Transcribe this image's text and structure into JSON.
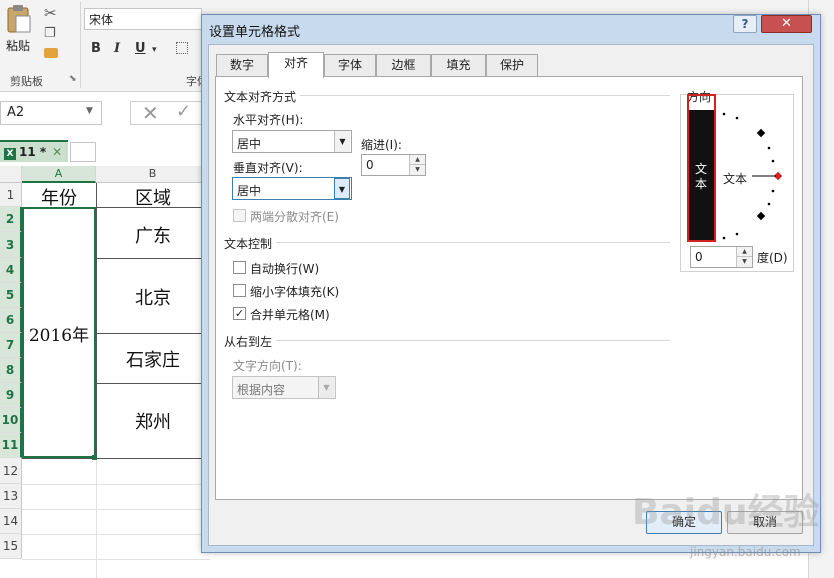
{
  "ribbon": {
    "paste_label": "粘贴",
    "clipboard_group": "剪贴板",
    "font_name": "宋体",
    "bold": "B",
    "italic": "I",
    "underline": "U",
    "font_group": "字体"
  },
  "formula_bar": {
    "name_box": "A2"
  },
  "sheet_tab": {
    "icon_text": "X",
    "label": "11 *",
    "close": "✕"
  },
  "grid": {
    "columns": [
      "A",
      "B"
    ],
    "rows": [
      "1",
      "2",
      "3",
      "4",
      "5",
      "6",
      "7",
      "8",
      "9",
      "10",
      "11",
      "12",
      "13",
      "14",
      "15"
    ],
    "cells": {
      "a1": "年份",
      "b1": "区域",
      "a_merged": "2016年",
      "b_gd": "广东",
      "b_bj": "北京",
      "b_sjz": "石家庄",
      "b_zz": "郑州"
    }
  },
  "dialog": {
    "title": "设置单元格格式",
    "help": "?",
    "close": "✕",
    "tabs": [
      "数字",
      "对齐",
      "字体",
      "边框",
      "填充",
      "保护"
    ],
    "active_tab": "对齐",
    "text_align": {
      "section": "文本对齐方式",
      "horizontal_label": "水平对齐(H):",
      "horizontal_value": "居中",
      "indent_label": "缩进(I):",
      "indent_value": "0",
      "vertical_label": "垂直对齐(V):",
      "vertical_value": "居中",
      "distributed_label": "两端分散对齐(E)",
      "distributed_checked": false
    },
    "text_control": {
      "section": "文本控制",
      "wrap_label": "自动换行(W)",
      "wrap_checked": false,
      "shrink_label": "缩小字体填充(K)",
      "shrink_checked": false,
      "merge_label": "合并单元格(M)",
      "merge_checked": true
    },
    "rtl": {
      "section": "从右到左",
      "direction_label": "文字方向(T):",
      "direction_value": "根据内容"
    },
    "orientation": {
      "section": "方向",
      "vertical_text": "文本",
      "dial_text": "文本",
      "degrees_value": "0",
      "degrees_label": "度(D)"
    },
    "ok_label": "确定",
    "cancel_label": "取消",
    "checkmark": "✓"
  },
  "watermark": {
    "brand": "Baidu经验",
    "url": "jingyan.baidu.com"
  }
}
